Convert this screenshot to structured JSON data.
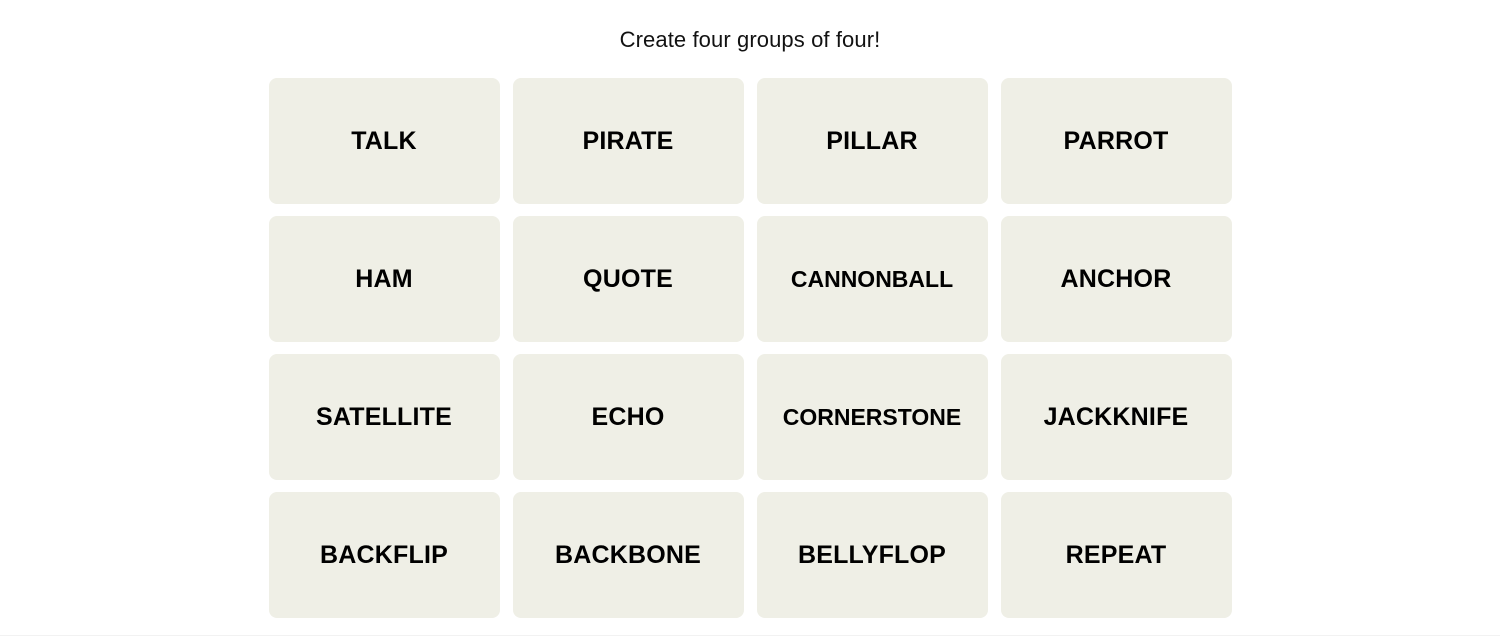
{
  "page": {
    "title": "Create four groups of four!",
    "background_color": "#ffffff"
  },
  "board": {
    "tile_background_color": "#efefe6",
    "tile_text_color": "#000000",
    "rows": 4,
    "columns": 4,
    "tiles": [
      {
        "label": "TALK"
      },
      {
        "label": "PIRATE"
      },
      {
        "label": "PILLAR"
      },
      {
        "label": "PARROT"
      },
      {
        "label": "HAM"
      },
      {
        "label": "QUOTE"
      },
      {
        "label": "CANNONBALL"
      },
      {
        "label": "ANCHOR"
      },
      {
        "label": "SATELLITE"
      },
      {
        "label": "ECHO"
      },
      {
        "label": "CORNERSTONE"
      },
      {
        "label": "JACKKNIFE"
      },
      {
        "label": "BACKFLIP"
      },
      {
        "label": "BACKBONE"
      },
      {
        "label": "BELLYFLOP"
      },
      {
        "label": "REPEAT"
      }
    ]
  }
}
